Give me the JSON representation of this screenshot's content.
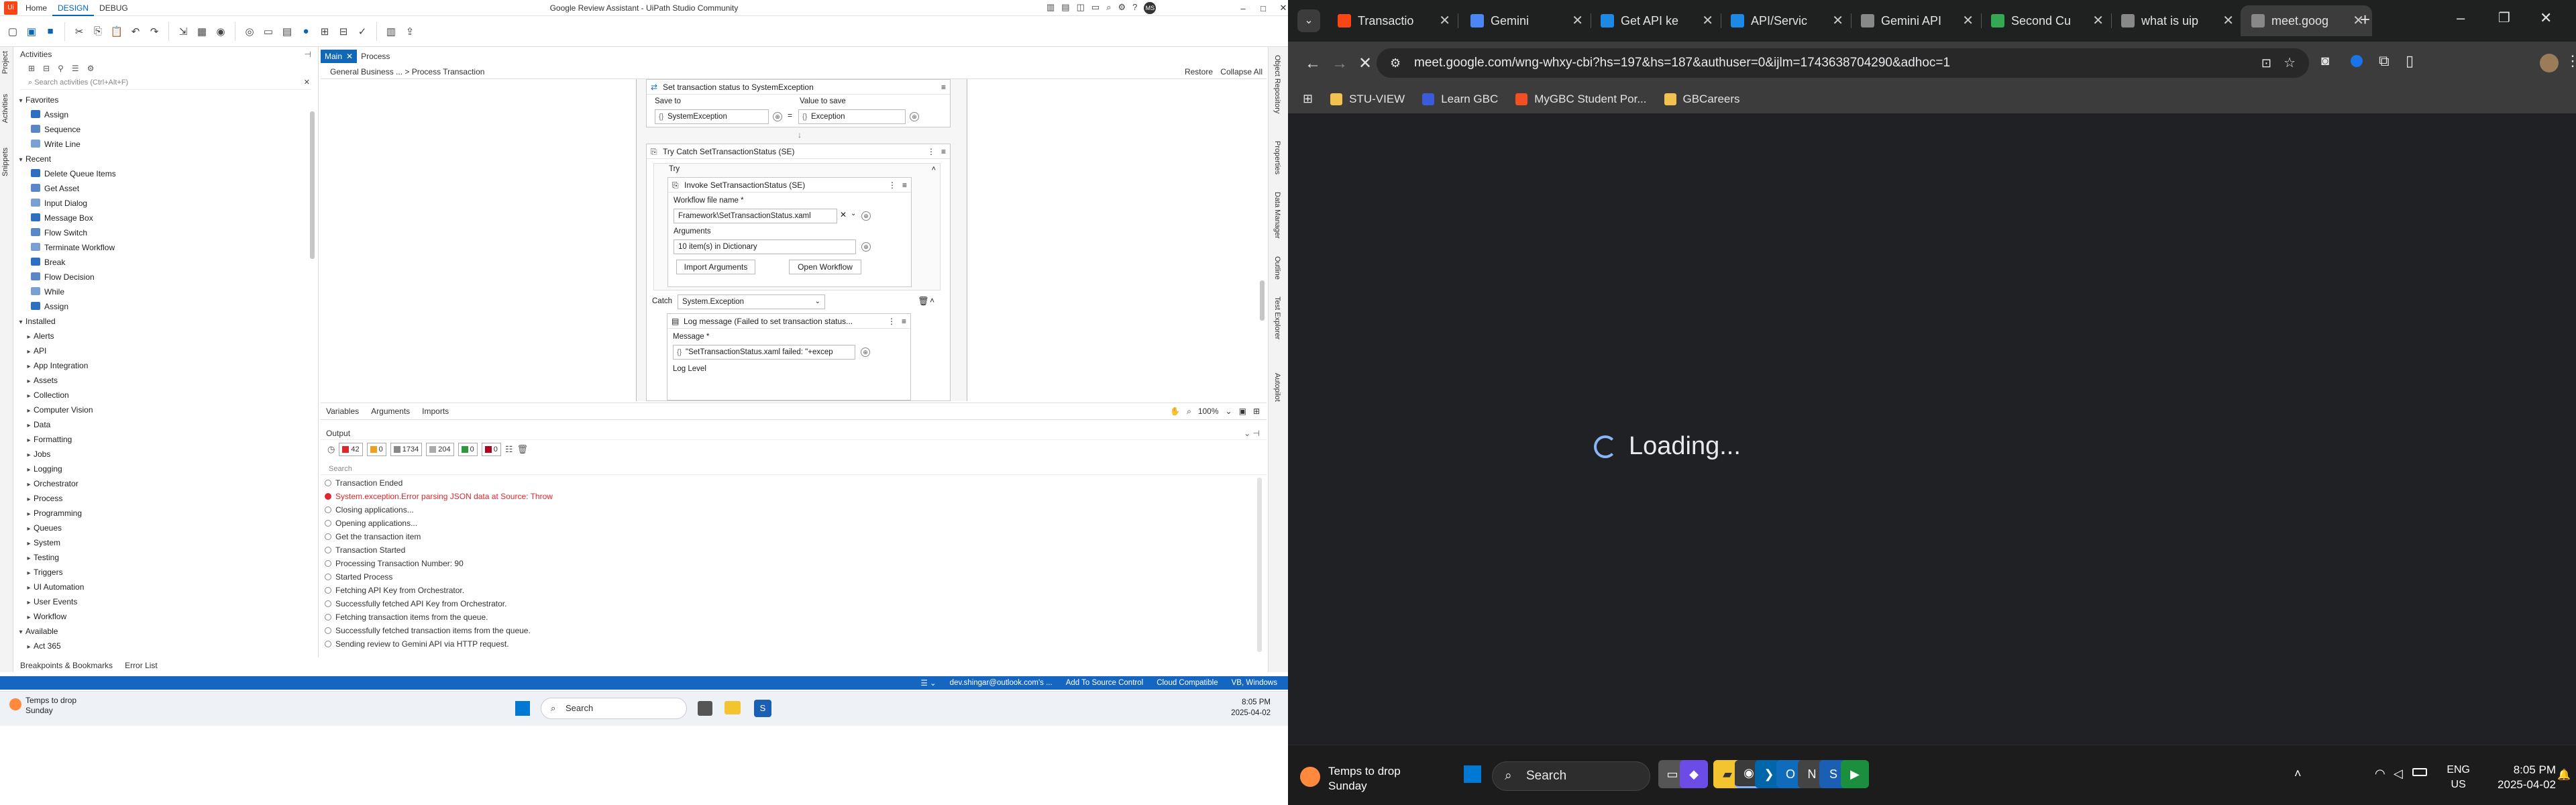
{
  "uipath": {
    "tabs": [
      "DESIGN",
      "DEBUG"
    ],
    "title": "Google Review Assistant - UiPath Studio Community",
    "activities": {
      "header": "Activities",
      "search_placeholder": "Search activities (Ctrl+Alt+F)",
      "favorites_label": "Favorites",
      "favorites": [
        "Assign",
        "Sequence",
        "Write Line"
      ],
      "recent_label": "Recent",
      "recent": [
        "Delete Queue Items",
        "Get Asset",
        "Input Dialog",
        "Message Box",
        "Flow Switch",
        "Terminate Workflow",
        "Break",
        "Flow Decision",
        "While",
        "Assign"
      ],
      "installed_label": "Installed",
      "installed": [
        "Alerts",
        "API",
        "App Integration",
        "Assets",
        "Collection",
        "Computer Vision",
        "Data",
        "Formatting",
        "Jobs",
        "Logging",
        "Orchestrator",
        "Process",
        "Programming",
        "Queues",
        "System",
        "Testing",
        "Triggers",
        "UI Automation",
        "User Events",
        "Workflow"
      ],
      "available_label": "Available",
      "available": [
        "Act 365"
      ]
    },
    "left_strip": [
      "Project",
      "Activities",
      "Snippets"
    ],
    "right_strip": [
      "Object Repository",
      "Properties",
      "Data Manager",
      "Outline",
      "Test Explorer",
      "Autopilot"
    ],
    "bottom_links": [
      "Breakpoints & Bookmarks",
      "Error List"
    ],
    "doc_tabs": [
      {
        "label": "Main"
      },
      {
        "label": "Process"
      }
    ],
    "breadcrumb": "General Business ... > Process Transaction",
    "restore": "Restore",
    "collapse_all": "Collapse All",
    "designer": {
      "set_status_title": "Set transaction status to SystemException",
      "save_to_label": "Save to",
      "save_to_value": "SystemException",
      "value_label": "Value to save",
      "value_value": "Exception",
      "try_catch_title": "Try Catch SetTransactionStatus (SE)",
      "try_label": "Try",
      "invoke_title": "Invoke SetTransactionStatus (SE)",
      "wf_file_label": "Workflow file name *",
      "wf_file_value": "Framework\\SetTransactionStatus.xaml",
      "arguments_label": "Arguments",
      "arguments_value": "10 item(s) in Dictionary",
      "import_args": "Import Arguments",
      "open_workflow": "Open Workflow",
      "catch_label": "Catch",
      "catch_value": "System.Exception",
      "log_title": "Log message (Failed to set transaction status...",
      "message_label": "Message *",
      "message_value": "\"SetTransactionStatus.xaml failed: \"+excep",
      "log_level_label": "Log Level"
    },
    "var_tabs": [
      "Variables",
      "Arguments",
      "Imports"
    ],
    "zoom": "100%",
    "output": {
      "header": "Output",
      "badges": [
        "42",
        "0",
        "1734",
        "204",
        "0",
        "0"
      ],
      "search_placeholder": "Search",
      "rows": [
        {
          "text": "Transaction Ended",
          "type": "info"
        },
        {
          "text": "System.exception.Error parsing JSON data at Source: Throw",
          "type": "error"
        },
        {
          "text": "Closing applications...",
          "type": "info"
        },
        {
          "text": "Opening applications...",
          "type": "info"
        },
        {
          "text": "Get the transaction item",
          "type": "info"
        },
        {
          "text": "Transaction Started",
          "type": "info"
        },
        {
          "text": "Processing Transaction Number: 90",
          "type": "info"
        },
        {
          "text": "Started Process",
          "type": "info"
        },
        {
          "text": "Fetching API Key from Orchestrator.",
          "type": "info"
        },
        {
          "text": "Successfully fetched API Key from Orchestrator.",
          "type": "info"
        },
        {
          "text": "Fetching transaction items from the queue.",
          "type": "info"
        },
        {
          "text": "Successfully fetched transaction items from the queue.",
          "type": "info"
        },
        {
          "text": "Sending review to Gemini API via HTTP request.",
          "type": "info"
        }
      ]
    },
    "statusbar": {
      "account": "dev.shingar@outlook.com's ...",
      "source_control": "Add To Source Control",
      "compat": "Cloud Compatible",
      "lang": "VB, Windows"
    },
    "taskbar": {
      "weather_title": "Temps to drop",
      "weather_sub": "Sunday",
      "search": "Search",
      "time": "8:05 PM",
      "date": "2025-04-02"
    }
  },
  "chrome": {
    "tabs": [
      {
        "label": "Transactio",
        "icon": "uipath-icon",
        "color": "#fa4616"
      },
      {
        "label": "Gemini",
        "icon": "gemini-icon",
        "color": "#4b86f2"
      },
      {
        "label": "Get API ke",
        "icon": "api-icon",
        "color": "#1e88e5"
      },
      {
        "label": "API/Servic",
        "icon": "rpi-icon",
        "color": "#1e88e5"
      },
      {
        "label": "Gemini API",
        "icon": "google-icon",
        "color": "#888888"
      },
      {
        "label": "Second Cu",
        "icon": "maps-icon",
        "color": "#34a853"
      },
      {
        "label": "what is uip",
        "icon": "google-icon",
        "color": "#888888"
      },
      {
        "label": "meet.goog",
        "icon": "loading-icon",
        "color": "#888888"
      }
    ],
    "url": "meet.google.com/wng-whxy-cbi?hs=197&hs=187&authuser=0&ijlm=1743638704290&adhoc=1",
    "bookmarks": [
      {
        "label": "STU-VIEW",
        "color": "#f2c14e"
      },
      {
        "label": "Learn GBC",
        "color": "#3b5bdb"
      },
      {
        "label": "MyGBC Student Por...",
        "color": "#f25022"
      },
      {
        "label": "GBCareers",
        "color": "#f2c14e"
      }
    ],
    "loading_text": "Loading...",
    "taskbar": {
      "weather_title": "Temps to drop",
      "weather_sub": "Sunday",
      "search": "Search",
      "lang1": "ENG",
      "lang2": "US",
      "time": "8:05 PM",
      "date": "2025-04-02"
    }
  }
}
